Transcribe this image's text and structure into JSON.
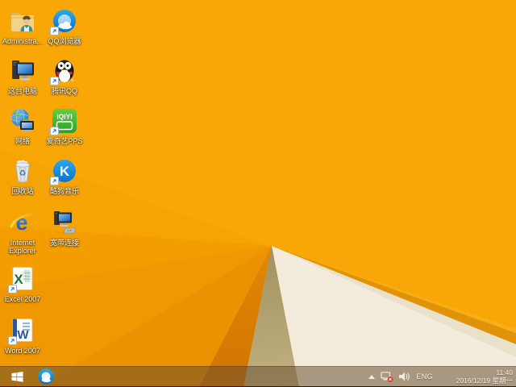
{
  "theme": {
    "colors": {
      "wp-base": "#F8A707",
      "wp-w1": "#F6A304",
      "wp-w2": "#F39D01",
      "wp-w3": "#F09801",
      "wp-w4": "#EC9101",
      "wp-dark-top": "#E58A00",
      "wp-dark-bottom": "#CE7303",
      "wp-olive-top": "#9A8A58",
      "wp-olive-bottom": "#C3B383",
      "wp-cream": "#F3ECDC",
      "wp-cream-shade": "#E9E1CB",
      "wp-edge": "#E09307",
      "wp-edge-hi": "#F7AD1C",
      "taskbar-text": "#F7F1E4",
      "shortcut-arrow-blue": "#1E62C8",
      "network-error-red": "#D43C2A"
    }
  },
  "desktop": {
    "icons": [
      {
        "label": "Administra...",
        "name": "administrator-folder"
      },
      {
        "label": "QQ浏览器",
        "name": "qq-browser"
      },
      {
        "label": "这台电脑",
        "name": "this-pc"
      },
      {
        "label": "腾讯QQ",
        "name": "tencent-qq"
      },
      {
        "label": "网络",
        "name": "network"
      },
      {
        "label": "爱奇艺PPS",
        "name": "iqiyi-pps"
      },
      {
        "label": "回收站",
        "name": "recycle-bin"
      },
      {
        "label": "酷狗音乐",
        "name": "kugou-music"
      },
      {
        "label": "Internet Explorer",
        "name": "internet-explorer"
      },
      {
        "label": "宽带连接",
        "name": "broadband-connection"
      },
      {
        "label": "Excel 2007",
        "name": "excel-2007"
      },
      {
        "label": "Word 2007",
        "name": "word-2007"
      }
    ]
  },
  "taskbar": {
    "tray": {
      "language": "ENG",
      "time": "11:40",
      "date": "2016/12/19 星期一"
    }
  }
}
